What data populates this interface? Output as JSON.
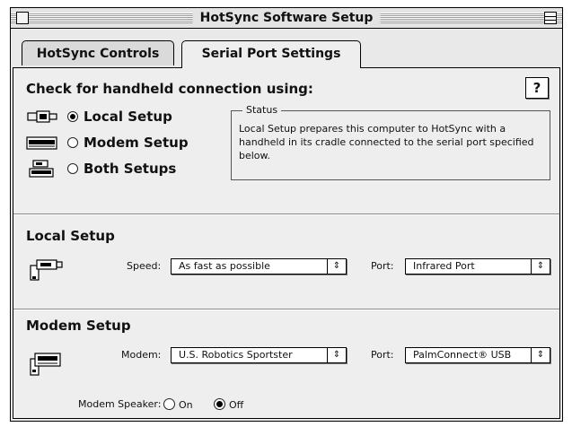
{
  "window": {
    "title": "HotSync Software Setup"
  },
  "tabs": [
    {
      "label": "HotSync Controls",
      "selected": false
    },
    {
      "label": "Serial Port Settings",
      "selected": true
    }
  ],
  "connection": {
    "heading": "Check for handheld connection using:",
    "help_label": "?",
    "options": [
      {
        "label": "Local Setup",
        "selected": true,
        "icon": "cradle-icon"
      },
      {
        "label": "Modem Setup",
        "selected": false,
        "icon": "modem-icon"
      },
      {
        "label": "Both Setups",
        "selected": false,
        "icon": "both-devices-icon"
      }
    ],
    "status": {
      "title": "Status",
      "text": "Local Setup prepares this computer to HotSync with a handheld in its cradle connected to the serial port specified below."
    }
  },
  "local_setup": {
    "heading": "Local Setup",
    "speed_label": "Speed:",
    "speed_value": "As fast as possible",
    "port_label": "Port:",
    "port_value": "Infrared Port"
  },
  "modem_setup": {
    "heading": "Modem Setup",
    "modem_label": "Modem:",
    "modem_value": "U.S. Robotics Sportster",
    "port_label": "Port:",
    "port_value": "PalmConnect® USB",
    "speaker_label": "Modem Speaker:",
    "speaker_on_label": "On",
    "speaker_off_label": "Off",
    "speaker_selected": "Off"
  },
  "popup_arrow_glyph": "⇕"
}
